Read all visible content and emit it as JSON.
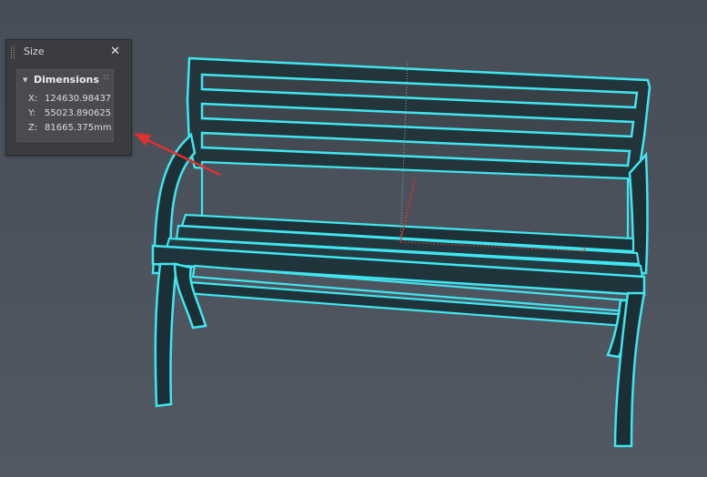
{
  "panel": {
    "title": "Size",
    "close_label": "✕",
    "section": {
      "title": "Dimensions",
      "rows": [
        {
          "label": "X:",
          "value": "124630.98437"
        },
        {
          "label": "Y:",
          "value": "55023.890625i"
        },
        {
          "label": "Z:",
          "value": "81665.375mm"
        }
      ]
    }
  },
  "viewport": {
    "object": "bench",
    "selection_color": "#3fe6f0",
    "object_color": "#1e3c42",
    "annotation_arrow_color": "#e03030",
    "axis_x_color": "#c0392b",
    "axis_y_color": "#9aa0a6",
    "axis_x_label": "x"
  }
}
